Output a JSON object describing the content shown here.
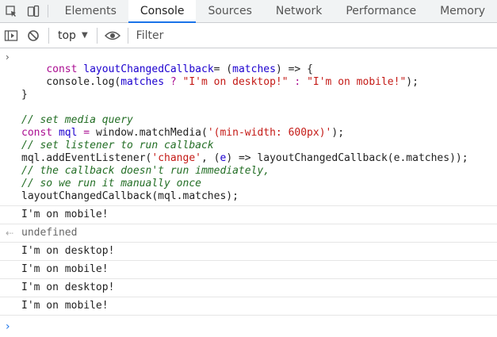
{
  "tabs": [
    {
      "label": "Elements",
      "active": false
    },
    {
      "label": "Console",
      "active": true
    },
    {
      "label": "Sources",
      "active": false
    },
    {
      "label": "Network",
      "active": false
    },
    {
      "label": "Performance",
      "active": false
    },
    {
      "label": "Memory",
      "active": false
    }
  ],
  "toolbar": {
    "context": "top",
    "filter_placeholder": "Filter"
  },
  "console": {
    "input_tokens": [
      [
        [
          "kw",
          "const "
        ],
        [
          "vn",
          "layoutChangedCallback"
        ],
        [
          "",
          "= ("
        ],
        [
          "vn",
          "matches"
        ],
        [
          "",
          ") => {"
        ]
      ],
      [
        [
          "",
          "    console.log("
        ],
        [
          "vn",
          "matches"
        ],
        [
          "kw",
          " ? "
        ],
        [
          "st",
          "\"I'm on desktop!\""
        ],
        [
          "kw",
          " : "
        ],
        [
          "st",
          "\"I'm on mobile!\""
        ],
        [
          "",
          ");"
        ]
      ],
      [
        [
          "",
          "}"
        ]
      ],
      [
        [
          "",
          ""
        ]
      ],
      [
        [
          "cm",
          "// set media query"
        ]
      ],
      [
        [
          "kw",
          "const "
        ],
        [
          "vn",
          "mql"
        ],
        [
          "",
          ""
        ],
        [
          "kw",
          " = "
        ],
        [
          "",
          "window.matchMedia("
        ],
        [
          "st",
          "'(min-width: 600px)'"
        ],
        [
          "",
          ");"
        ]
      ],
      [
        [
          "cm",
          "// set listener to run callback"
        ]
      ],
      [
        [
          "",
          "mql.addEventListener("
        ],
        [
          "st",
          "'change'"
        ],
        [
          "",
          ", ("
        ],
        [
          "vn",
          "e"
        ],
        [
          "",
          ") => layoutChangedCallback(e.matches));"
        ]
      ],
      [
        [
          "cm",
          "// the callback doesn't run immediately,"
        ]
      ],
      [
        [
          "cm",
          "// so we run it manually once"
        ]
      ],
      [
        [
          "",
          "layoutChangedCallback(mql.matches);"
        ]
      ]
    ],
    "messages": [
      {
        "text": "I'm on mobile!",
        "kind": "log"
      },
      {
        "text": "undefined",
        "kind": "result"
      },
      {
        "text": "I'm on desktop!",
        "kind": "log"
      },
      {
        "text": "I'm on mobile!",
        "kind": "log"
      },
      {
        "text": "I'm on desktop!",
        "kind": "log"
      },
      {
        "text": "I'm on mobile!",
        "kind": "log"
      }
    ]
  },
  "colors": {
    "accent": "#1a73e8",
    "keyword": "#aa0d91",
    "variable": "#1c00cf",
    "comment": "#236e25",
    "string": "#c41a16"
  }
}
